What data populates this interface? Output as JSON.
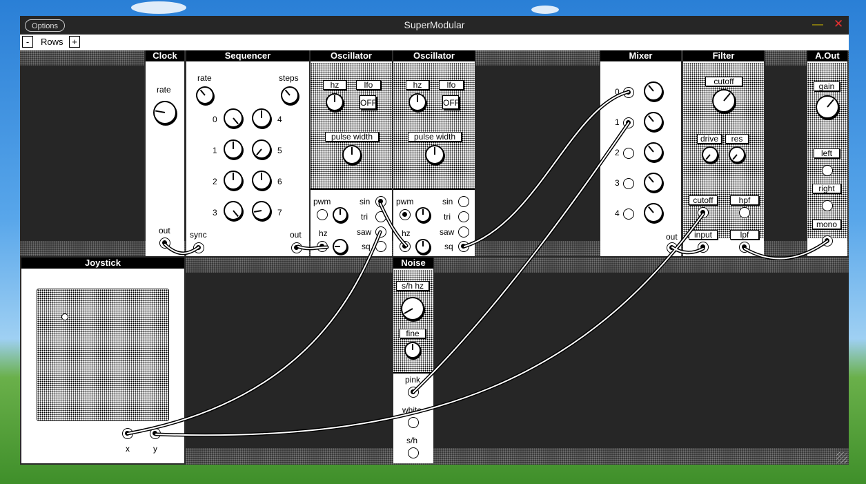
{
  "window": {
    "title": "SuperModular",
    "options_label": "Options",
    "minimize_icon": "minimize-icon",
    "close_icon": "close-icon"
  },
  "rows_bar": {
    "minus": "-",
    "label": "Rows",
    "plus": "+"
  },
  "clock": {
    "title": "Clock",
    "rate": "rate",
    "out": "out"
  },
  "sequencer": {
    "title": "Sequencer",
    "rate": "rate",
    "steps": "steps",
    "step_labels": [
      "0",
      "1",
      "2",
      "3",
      "4",
      "5",
      "6",
      "7"
    ],
    "sync": "sync",
    "out": "out"
  },
  "osc1": {
    "title": "Oscillator",
    "hz": "hz",
    "lfo": "lfo",
    "off": "OFF",
    "pulse_width": "pulse width",
    "pwm": "pwm",
    "hz_in": "hz",
    "sin": "sin",
    "tri": "tri",
    "saw": "saw",
    "sq": "sq"
  },
  "osc2": {
    "title": "Oscillator",
    "hz": "hz",
    "lfo": "lfo",
    "off": "OFF",
    "pulse_width": "pulse width",
    "pwm": "pwm",
    "hz_in": "hz",
    "sin": "sin",
    "tri": "tri",
    "saw": "saw",
    "sq": "sq"
  },
  "mixer": {
    "title": "Mixer",
    "channels": [
      "0",
      "1",
      "2",
      "3",
      "4"
    ],
    "out": "out"
  },
  "filter": {
    "title": "Filter",
    "cutoff": "cutoff",
    "drive": "drive",
    "res": "res",
    "cutoff_in": "cutoff",
    "hpf": "hpf",
    "input": "input",
    "lpf": "lpf"
  },
  "aout": {
    "title": "A.Out",
    "gain": "gain",
    "left": "left",
    "right": "right",
    "mono": "mono"
  },
  "joystick": {
    "title": "Joystick",
    "x": "x",
    "y": "y"
  },
  "noise": {
    "title": "Noise",
    "sh_hz": "s/h hz",
    "fine": "fine",
    "pink": "pink",
    "white": "white",
    "sh": "s/h"
  }
}
